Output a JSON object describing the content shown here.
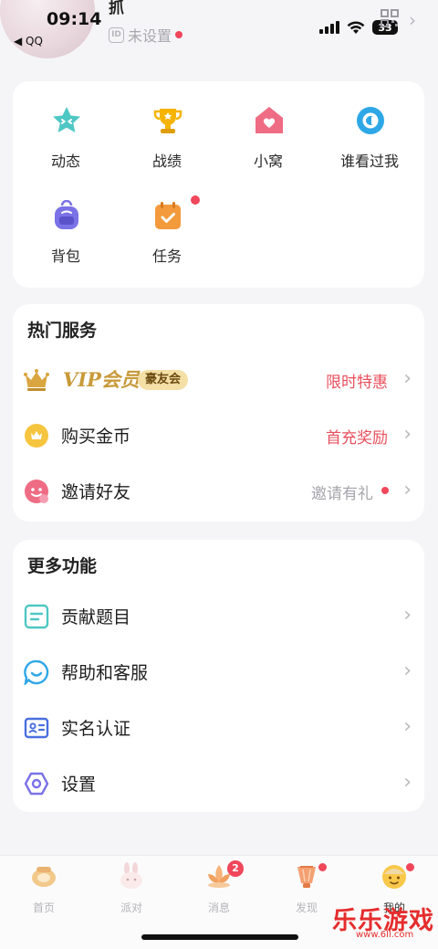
{
  "status_bar": {
    "time": "09:14",
    "back_app": "◀ QQ",
    "battery": "33"
  },
  "profile": {
    "nickname": "抓",
    "id_badge": "ID",
    "id_text": "未设置"
  },
  "grid": [
    {
      "label": "动态",
      "icon": "star-face-icon",
      "color": "#4fc7c4"
    },
    {
      "label": "战绩",
      "icon": "trophy-icon",
      "color": "#f4b400"
    },
    {
      "label": "小窝",
      "icon": "house-heart-icon",
      "color": "#ee6c84"
    },
    {
      "label": "谁看过我",
      "icon": "eye-icon",
      "color": "#2ea7e6"
    },
    {
      "label": "背包",
      "icon": "backpack-icon",
      "color": "#7a72e6"
    },
    {
      "label": "任务",
      "icon": "calendar-check-icon",
      "color": "#f39a3c"
    }
  ],
  "hot_services": {
    "title": "热门服务",
    "vip": {
      "title": "VIP会员",
      "badge": "豪友会",
      "right": "限时特惠"
    },
    "coin": {
      "label": "购买金币",
      "right": "首充奖励"
    },
    "invite": {
      "label": "邀请好友",
      "right": "邀请有礼"
    }
  },
  "more": {
    "title": "更多功能",
    "items": [
      {
        "label": "贡献题目",
        "icon": "document-icon"
      },
      {
        "label": "帮助和客服",
        "icon": "chat-bubble-icon"
      },
      {
        "label": "实名认证",
        "icon": "id-card-icon"
      },
      {
        "label": "设置",
        "icon": "hexagon-settings-icon"
      }
    ]
  },
  "tabbar": [
    {
      "label": "首页",
      "icon": "home-ring-icon"
    },
    {
      "label": "派对",
      "icon": "bunny-icon"
    },
    {
      "label": "消息",
      "icon": "lotus-icon",
      "badge": "2"
    },
    {
      "label": "发现",
      "icon": "lantern-icon"
    },
    {
      "label": "我的",
      "icon": "sun-face-icon"
    }
  ],
  "colors": {
    "accent_red": "#f0475b",
    "promo_red": "#e8505e",
    "gold": "#c89a3a"
  },
  "watermark": {
    "title": "乐乐游戏",
    "url": "www.6ll.com"
  }
}
